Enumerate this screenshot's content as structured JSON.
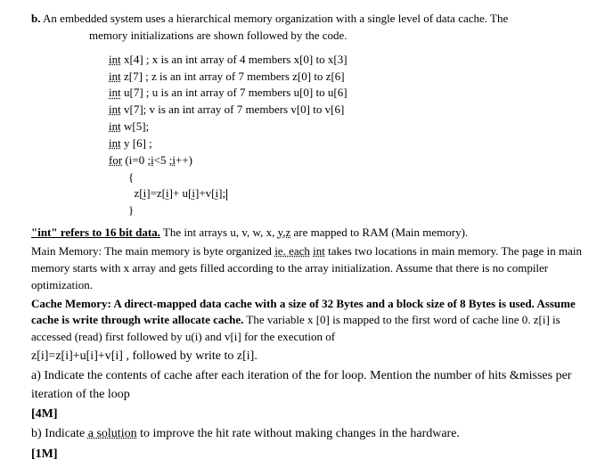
{
  "header": {
    "label": "b.",
    "intro1": "An embedded system uses a hierarchical memory organization with a single level of data cache. The",
    "intro2": "memory initializations are shown followed by the code."
  },
  "code": {
    "l1a": "int",
    "l1b": " x[4] ; x is an int array of 4 members x[0] to x[3]",
    "l2a": "int",
    "l2b": " z[7] ; z is an int array of 7 members z[0] to z[6]",
    "l3a": "int",
    "l3b": " u[7] ; u is an int array of 7 members u[0] to u[6]",
    "l4a": "int",
    "l4b": " v[7]; v is an int array of 7 members v[0] to v[6]",
    "l5a": "int",
    "l5b": " w[5];",
    "l6a": "int",
    "l6b": " y [6] ;",
    "l7a": "for",
    "l7b1": " (i=0 ;",
    "l7b2": "i",
    "l7b3": "<5 ;",
    "l7b4": "i",
    "l7b5": "++)",
    "l8": "{",
    "l9a": "z[",
    "l9b": "i",
    "l9c": "]=z[",
    "l9d": "i",
    "l9e": "]+ u[",
    "l9f": "i",
    "l9g": "]+v[",
    "l9h": "i",
    "l9i": "];",
    "l10": "}"
  },
  "para1": {
    "a": "\"int\" refers to 16 bit data.",
    "b": " The int arrays u, v, w, x, ",
    "c": "y,z",
    "d": " are mapped to RAM (Main memory)."
  },
  "para2": {
    "a": "Main Memory: The main memory is byte organized ",
    "b": "ie. each",
    "c": " ",
    "d": "int",
    "e": " takes two locations in main memory. The page in main memory starts with x array and gets filled according to the array initialization. Assume that there is no compiler optimization."
  },
  "para3": {
    "a": "Cache Memory: A direct-mapped data cache with a size of 32 Bytes and a block size of 8 Bytes is used. Assume cache is write through write allocate cache.",
    "b": " The variable x [0] is mapped to the first word of cache line 0.  z[i] is accessed (read) first followed by u(i) and v[i] for the execution of"
  },
  "para4": "z[i]=z[i]+u[i]+v[i] , followed by write to z[i].",
  "qa": {
    "a": "a)   Indicate the contents of cache after each iteration of the for loop. Mention the number of hits &misses per iteration of the loop",
    "marks": "[4M]"
  },
  "qb": {
    "a": "b)   Indicate ",
    "b": "a   solution",
    "c": " to improve the hit rate without making changes in the hardware.",
    "marks": "[1M]"
  }
}
